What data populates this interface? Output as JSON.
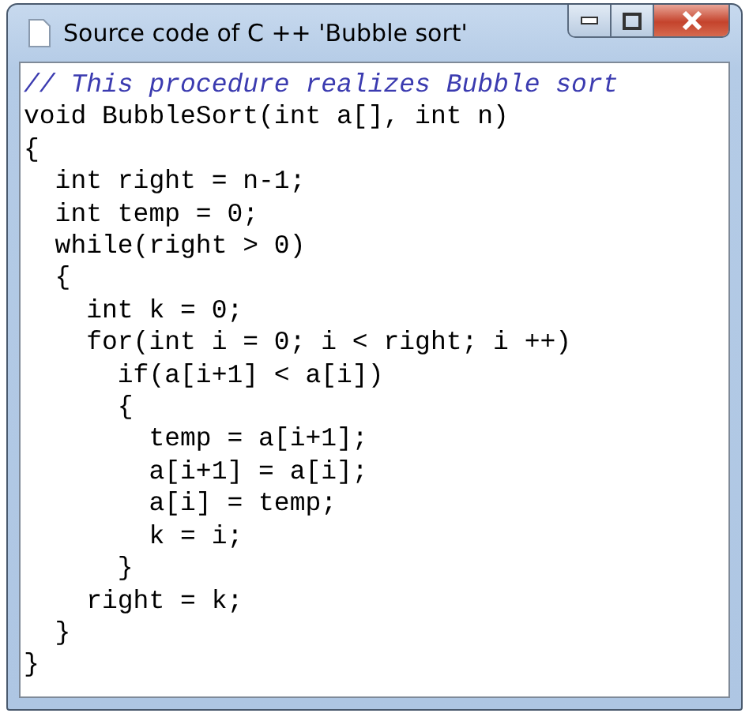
{
  "window": {
    "title": "Source code of C ++ 'Bubble sort'"
  },
  "code": {
    "lines": [
      {
        "kind": "comment",
        "text": "// This procedure realizes Bubble sort"
      },
      {
        "kind": "code",
        "text": "void BubbleSort(int a[], int n)"
      },
      {
        "kind": "code",
        "text": "{"
      },
      {
        "kind": "code",
        "text": "  int right = n-1;"
      },
      {
        "kind": "code",
        "text": "  int temp = 0;"
      },
      {
        "kind": "code",
        "text": "  while(right > 0)"
      },
      {
        "kind": "code",
        "text": "  {"
      },
      {
        "kind": "code",
        "text": "    int k = 0;"
      },
      {
        "kind": "code",
        "text": "    for(int i = 0; i < right; i ++)"
      },
      {
        "kind": "code",
        "text": "      if(a[i+1] < a[i])"
      },
      {
        "kind": "code",
        "text": "      {"
      },
      {
        "kind": "code",
        "text": "        temp = a[i+1];"
      },
      {
        "kind": "code",
        "text": "        a[i+1] = a[i];"
      },
      {
        "kind": "code",
        "text": "        a[i] = temp;"
      },
      {
        "kind": "code",
        "text": "        k = i;"
      },
      {
        "kind": "code",
        "text": "      }"
      },
      {
        "kind": "code",
        "text": "    right = k;"
      },
      {
        "kind": "code",
        "text": "  }"
      },
      {
        "kind": "code",
        "text": "}"
      }
    ]
  }
}
